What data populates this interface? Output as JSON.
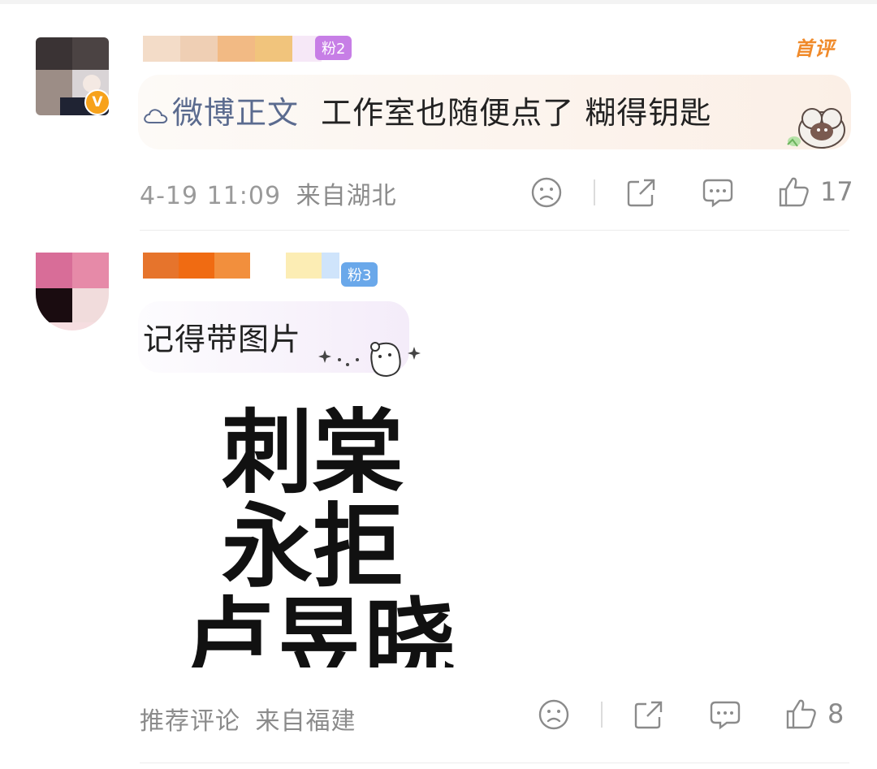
{
  "comments": [
    {
      "fan_badge": "粉2",
      "first_badge": "首评",
      "link_text": "微博正文",
      "text": "工作室也随便点了 糊得钥匙",
      "time": "4-19 11:09",
      "location": "来自湖北",
      "like_count": "17",
      "verified_badge": "V",
      "colors": {
        "fan_badge": "#c77ee6",
        "link": "#5b6b8f",
        "bubble": "#fbefe6"
      }
    },
    {
      "fan_badge": "粉3",
      "text": "记得带图片",
      "image_text_lines": [
        "刺棠",
        "永拒",
        "卢昱晓"
      ],
      "tag": "推荐评论",
      "location": "来自福建",
      "like_count": "8",
      "colors": {
        "fan_badge": "#6aa8ea",
        "bubble": "#f7f1fb"
      }
    }
  ],
  "icons": {
    "dislike": "frown-face-icon",
    "repost": "repost-icon",
    "comment": "comment-icon",
    "like": "thumbs-up-icon",
    "link": "cloud-link-icon"
  }
}
